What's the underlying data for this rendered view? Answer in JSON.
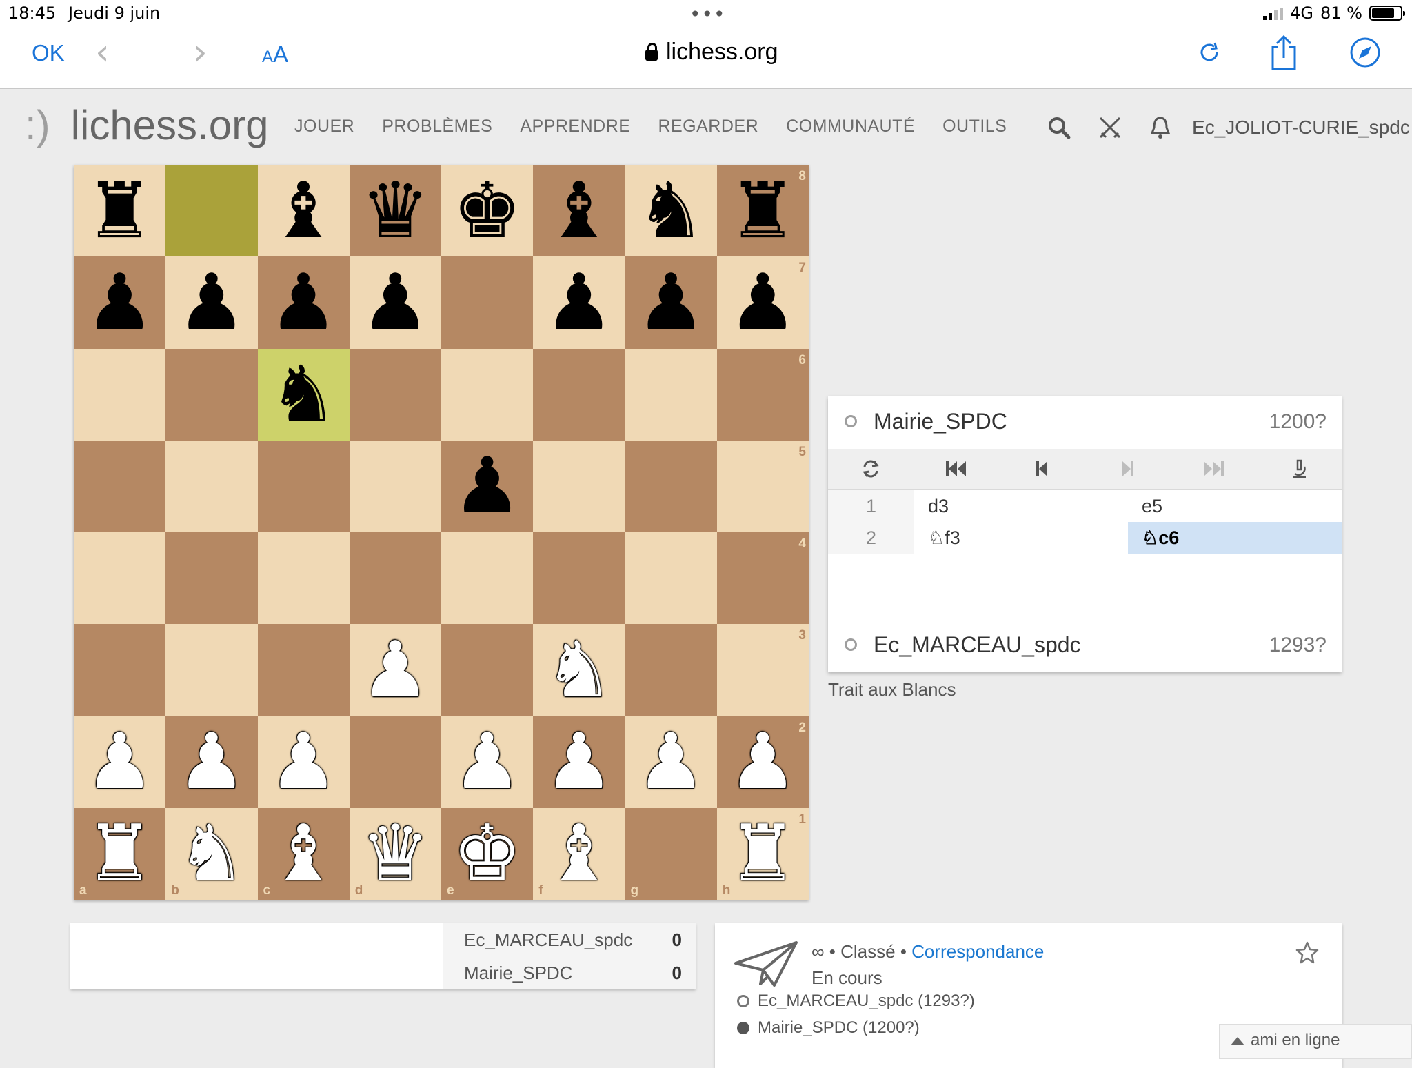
{
  "status_bar": {
    "time": "18:45",
    "date": "Jeudi 9 juin",
    "network": "4G",
    "battery": "81 %",
    "battery_level": 0.81
  },
  "browser": {
    "done_label": "OK",
    "text_size_small": "A",
    "text_size_large": "A",
    "url": "lichess.org"
  },
  "site": {
    "logo_smile": ":)",
    "logo_text": "lichess.org",
    "nav": [
      "JOUER",
      "PROBLÈMES",
      "APPRENDRE",
      "REGARDER",
      "COMMUNAUTÉ",
      "OUTILS"
    ],
    "username": "Ec_JOLIOT-CURIE_spdc"
  },
  "board": {
    "orientation": "white",
    "ranks": [
      "8",
      "7",
      "6",
      "5",
      "4",
      "3",
      "2",
      "1"
    ],
    "files": [
      "a",
      "b",
      "c",
      "d",
      "e",
      "f",
      "g",
      "h"
    ],
    "position": [
      [
        "r",
        "",
        "b",
        "q",
        "k",
        "b",
        "n",
        "r"
      ],
      [
        "p",
        "p",
        "p",
        "p",
        "",
        "p",
        "p",
        "p"
      ],
      [
        "",
        "",
        "n",
        "",
        "",
        "",
        "",
        ""
      ],
      [
        "",
        "",
        "",
        "",
        "p",
        "",
        "",
        ""
      ],
      [
        "",
        "",
        "",
        "",
        "",
        "",
        "",
        ""
      ],
      [
        "",
        "",
        "",
        "P",
        "",
        "N",
        "",
        ""
      ],
      [
        "P",
        "P",
        "P",
        "",
        "P",
        "P",
        "P",
        "P"
      ],
      [
        "R",
        "N",
        "B",
        "Q",
        "K",
        "B",
        "",
        "R"
      ]
    ],
    "last_move": [
      "b8",
      "c6"
    ]
  },
  "game_panel": {
    "top_player": {
      "name": "Mairie_SPDC",
      "rating": "1200?"
    },
    "bottom_player": {
      "name": "Ec_MARCEAU_spdc",
      "rating": "1293?"
    },
    "moves": [
      {
        "num": "1",
        "white": "d3",
        "black": "e5"
      },
      {
        "num": "2",
        "white": "♘f3",
        "black": "♘c6"
      }
    ],
    "active_move": "2b",
    "status": "Trait aux Blancs"
  },
  "crosstable": [
    {
      "name": "Ec_MARCEAU_spdc",
      "score": "0"
    },
    {
      "name": "Mairie_SPDC",
      "score": "0"
    }
  ],
  "game_info": {
    "time_control": "∞",
    "sep1": " • ",
    "rated": "Classé",
    "sep2": " • ",
    "speed": "Correspondance",
    "state": "En cours",
    "white_player": "Ec_MARCEAU_spdc (1293?)",
    "black_player": "Mairie_SPDC (1200?)"
  },
  "friends_box": {
    "label": "ami en ligne"
  },
  "colors": {
    "light_square": "#f0d9b5",
    "dark_square": "#b58863",
    "link": "#1b78d0",
    "ios_blue": "#1a74d8",
    "move_highlight": "#d0e2f5"
  }
}
